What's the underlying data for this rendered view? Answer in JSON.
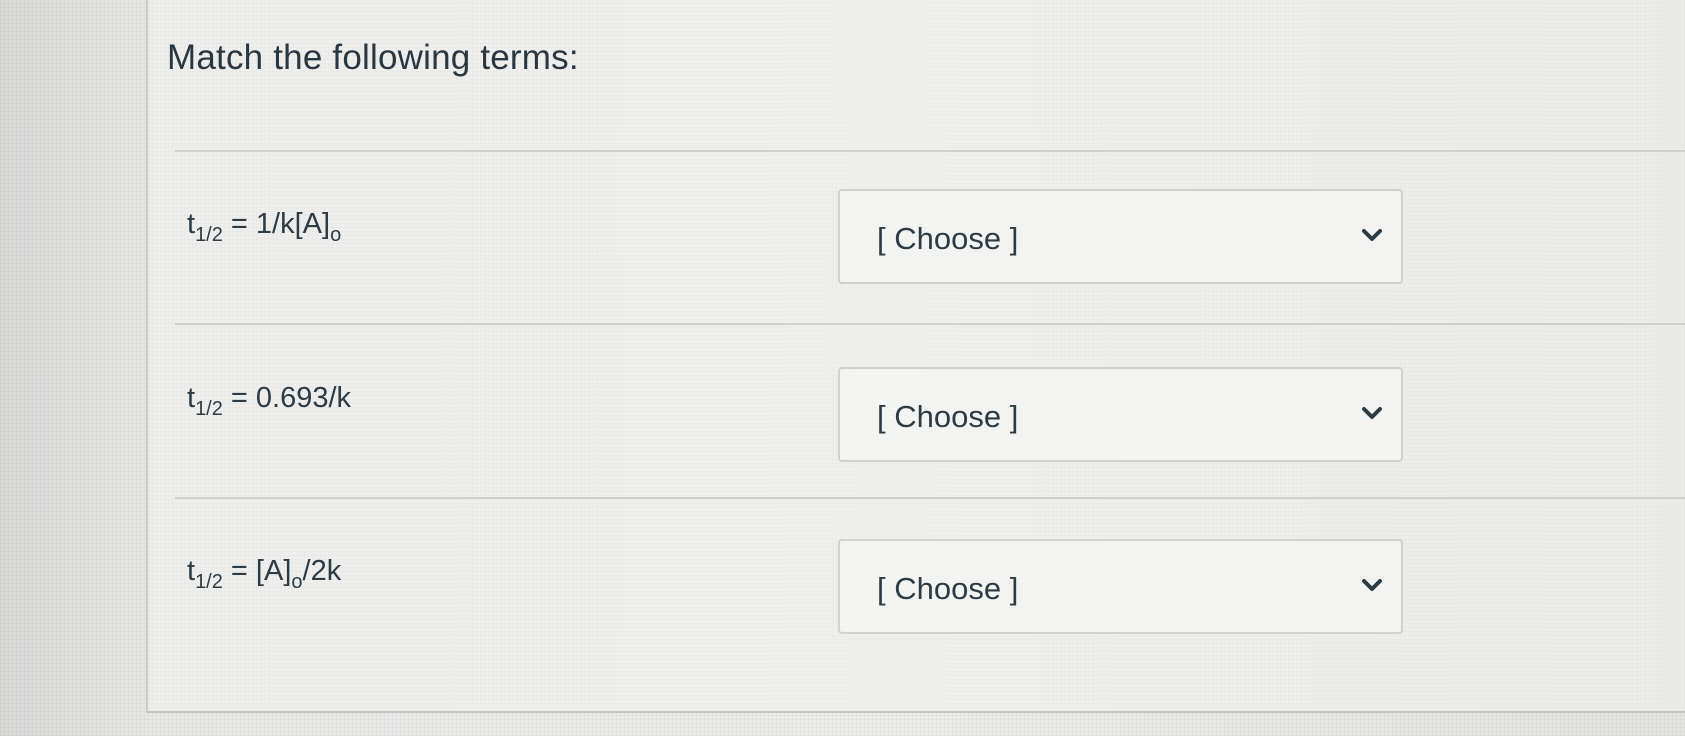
{
  "question": {
    "title": "Match the following terms:"
  },
  "rows": [
    {
      "term": {
        "var": "t",
        "sub": "1/2",
        "mid": " = 1/k[A]",
        "sub2": "o",
        "tail": ""
      },
      "select": {
        "value": "[ Choose ]",
        "icon": "chevron-down-icon"
      }
    },
    {
      "term": {
        "var": "t",
        "sub": "1/2",
        "mid": " = 0.693/k",
        "sub2": "",
        "tail": ""
      },
      "select": {
        "value": "[ Choose ]",
        "icon": "chevron-down-icon"
      }
    },
    {
      "term": {
        "var": "t",
        "sub": "1/2",
        "mid": " = [A]",
        "sub2": "o",
        "tail": "/2k"
      },
      "select": {
        "value": "[ Choose ]",
        "icon": "chevron-down-icon"
      }
    }
  ],
  "colors": {
    "text": "#2d3b45",
    "border": "#cfd2cf",
    "background": "#e6e7e5"
  }
}
